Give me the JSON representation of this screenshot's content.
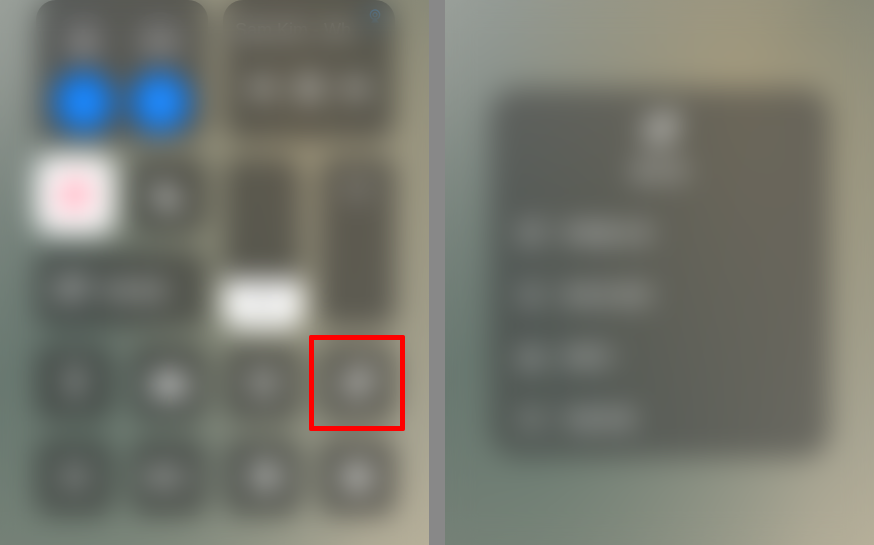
{
  "left": {
    "music": {
      "now_playing": "Sam Kim - Wh…"
    },
    "screen_mirror": {
      "label": "屏幕镜像"
    }
  },
  "right": {
    "notes": {
      "title": "备忘录",
      "items": [
        {
          "label": "新建备忘录"
        },
        {
          "label": "新核对清单"
        },
        {
          "label": "新照片"
        },
        {
          "label": "扫描文稿"
        }
      ]
    }
  }
}
